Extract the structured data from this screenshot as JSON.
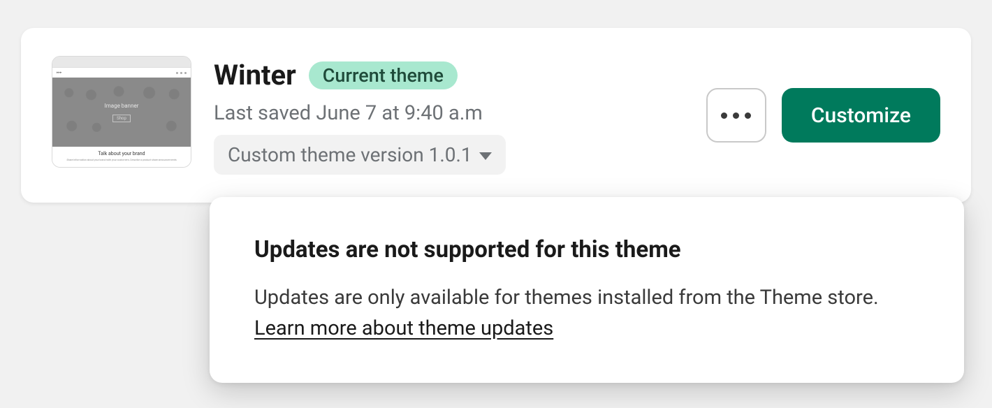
{
  "theme": {
    "name": "Winter",
    "badge_label": "Current theme",
    "last_saved": "Last saved June 7 at 9:40 a.m",
    "version_label": "Custom theme version 1.0.1"
  },
  "thumbnail": {
    "hero_label": "Image banner",
    "hero_button": "Shop",
    "bottom_title": "Talk about your brand",
    "bottom_sub": "Share information about your brand with your customers. Describe a product share announcements"
  },
  "actions": {
    "customize_label": "Customize"
  },
  "popover": {
    "title": "Updates are not supported for this theme",
    "body_prefix": "Updates are only available for themes installed from the Theme store. ",
    "link_text": "Learn more about theme updates"
  }
}
